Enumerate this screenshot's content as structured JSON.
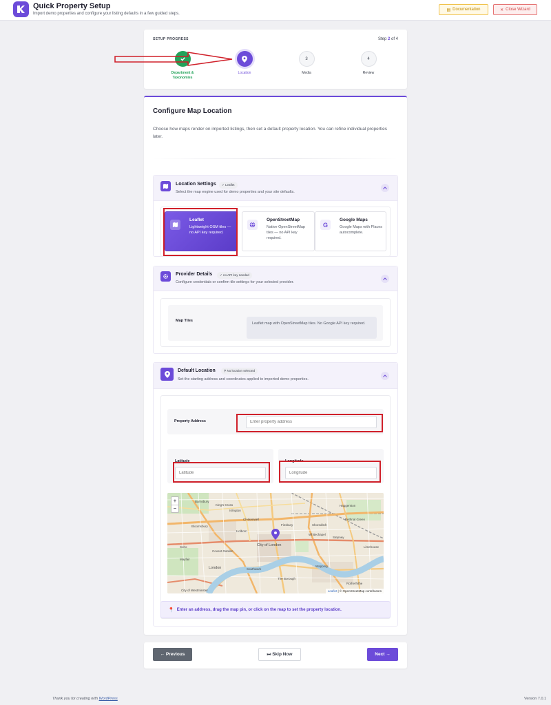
{
  "header": {
    "title": "Quick Property Setup",
    "subtitle": "Import demo properties and configure your listing defaults in a few guided steps.",
    "documentation_label": "Documentation",
    "close_label": "Close Wizard"
  },
  "progress": {
    "label": "SETUP PROGRESS",
    "step_prefix": "Step",
    "current": "2",
    "step_suffix": "of 4",
    "steps": [
      {
        "number": "1",
        "label": "Department & Taxonomies",
        "state": "done"
      },
      {
        "number": "2",
        "label": "Location",
        "state": "active"
      },
      {
        "number": "3",
        "label": "Media",
        "state": "pending"
      },
      {
        "number": "4",
        "label": "Review",
        "state": "pending"
      }
    ]
  },
  "main": {
    "title": "Configure Map Location",
    "description": "Choose how maps render on imported listings, then set a default property location. You can refine individual properties later."
  },
  "location_settings": {
    "title": "Location Settings",
    "badge": "✓ Leaflet",
    "subtitle": "Select the map engine used for demo properties and your site defaults.",
    "options": [
      {
        "title": "Leaflet",
        "description": "Lightweight OSM tiles — no API key required.",
        "selected": true,
        "icon": "map-icon"
      },
      {
        "title": "OpenStreetMap",
        "description": "Native OpenStreetMap tiles — no API key required.",
        "selected": false,
        "icon": "globe-icon"
      },
      {
        "title": "Google Maps",
        "description": "Google Maps with Places autocomplete.",
        "selected": false,
        "icon": "google-icon"
      }
    ]
  },
  "provider_details": {
    "title": "Provider Details",
    "badge": "✓ no API key needed",
    "subtitle": "Configure credentials or confirm tile settings for your selected provider.",
    "map_tiles_label": "Map Tiles",
    "map_tiles_info": "Leaflet map with OpenStreetMap tiles. No Google API key required."
  },
  "default_location": {
    "title": "Default Location",
    "badge": "No location selected",
    "subtitle": "Set the starting address and coordinates applied to imported demo properties.",
    "address_label": "Property Address",
    "address_placeholder": "Enter property address",
    "latitude_label": "Latitude",
    "latitude_placeholder": "Latitude",
    "longitude_label": "Longitude",
    "longitude_placeholder": "Longitude",
    "hint": "Enter an address, drag the map pin, or click on the map to set the property location."
  },
  "map": {
    "zoom_in": "+",
    "zoom_out": "−",
    "attribution_leaflet": "Leaflet",
    "attribution_rest": "| © OpenStreetMap contributors",
    "places": [
      {
        "name": "Barnsbury"
      },
      {
        "name": "King's Cross"
      },
      {
        "name": "Islington"
      },
      {
        "name": "Clerkenwell"
      },
      {
        "name": "Bloomsbury"
      },
      {
        "name": "Holborn"
      },
      {
        "name": "Finsbury"
      },
      {
        "name": "Haggerston"
      },
      {
        "name": "Bethnal Green"
      },
      {
        "name": "Shoreditch"
      },
      {
        "name": "Soho"
      },
      {
        "name": "Covent Garden"
      },
      {
        "name": "City of London"
      },
      {
        "name": "Whitechapel"
      },
      {
        "name": "Stepney"
      },
      {
        "name": "Mayfair"
      },
      {
        "name": "London"
      },
      {
        "name": "Southwark"
      },
      {
        "name": "Wapping"
      },
      {
        "name": "Limehouse"
      },
      {
        "name": "The Borough"
      },
      {
        "name": "Rotherhithe"
      },
      {
        "name": "City of Westminster"
      }
    ]
  },
  "footer": {
    "previous_label": "Previous",
    "skip_label": "Skip Now",
    "next_label": "Next",
    "thanks_prefix": "Thank you for creating with",
    "thanks_link": "WordPress",
    "version": "Version 7.0.1"
  },
  "colors": {
    "accent": "#6c4bd9",
    "success": "#22a35a",
    "annotation": "#d0202a"
  }
}
